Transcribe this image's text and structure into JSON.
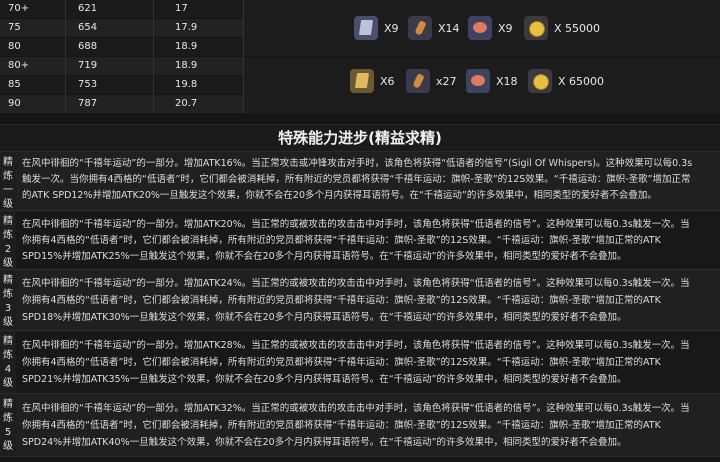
{
  "stats_rows": [
    {
      "level": "70+",
      "atk": "621",
      "sub": "17"
    },
    {
      "level": "75",
      "atk": "654",
      "sub": "17.9"
    },
    {
      "level": "80",
      "atk": "688",
      "sub": "18.9"
    },
    {
      "level": "80+",
      "atk": "719",
      "sub": "18.9"
    },
    {
      "level": "85",
      "atk": "753",
      "sub": "19.8"
    },
    {
      "level": "90",
      "atk": "787",
      "sub": "20.7"
    }
  ],
  "materials": [
    {
      "items": [
        {
          "icon": "book-icon",
          "qty": "X9"
        },
        {
          "icon": "bottle-icon",
          "qty": "X14"
        },
        {
          "icon": "mask-icon",
          "qty": "X9"
        },
        {
          "icon": "coin-icon",
          "qty": "X 55000"
        }
      ]
    },
    {
      "items": [
        {
          "icon": "golden-book-icon",
          "qty": "X6"
        },
        {
          "icon": "bottle-icon",
          "qty": "x27"
        },
        {
          "icon": "mask-icon",
          "qty": "X18"
        },
        {
          "icon": "coin-icon",
          "qty": "X 65000"
        }
      ]
    }
  ],
  "section_title": "特殊能力进步(精益求精)",
  "refinements": [
    {
      "tag": "精炼一级",
      "lines": [
        "在风中徘徊的“千禧年运动”的一部分。增加ATK16%。当正常攻击或冲锋攻击对手时，该角色将获得“低语者的信号”(Sigil Of Whispers)。这种效果可以每0.3s",
        "触发一次。当你拥有4西格的“低语者”时，它们都会被消耗掉，所有附近的党员都将获得“千禧年运动：旗帜-圣歌”的12S效果。“千禧运动：旗帜-圣歌”增加正常",
        "的ATK SPD12%并增加ATK20%一旦触发这个效果，你就不会在20多个月内获得耳语符号。在“千禧运动”的许多效果中，相同类型的爱好者不会叠加。"
      ]
    },
    {
      "tag": "精炼2级",
      "lines": [
        "在风中徘徊的“千禧年运动”的一部分。增加ATK20%。当正常的或被攻击的攻击击中对手时，该角色将获得“低语者的信号”。这种效果可以每0.3s触发一次。当",
        "你拥有4西格的“低语者”时，它们都会被消耗掉，所有附近的党员都将获得“千禧年运动：旗帜-圣歌”的12S效果。“千禧运动：旗帜-圣歌”增加正常的ATK",
        "SPD15%并增加ATK25%一旦触发这个效果，你就不会在20多个月内获得耳语符号。在“千禧运动”的许多效果中，相同类型的爱好者不会叠加。"
      ]
    },
    {
      "tag": "精炼3级",
      "lines": [
        "在风中徘徊的“千禧年运动”的一部分。增加ATK24%。当正常的或被攻击的攻击击中对手时，该角色将获得“低语者的信号”。这种效果可以每0.3s触发一次。当",
        "你拥有4西格的“低语者”时，它们都会被消耗掉，所有附近的党员都将获得“千禧年运动：旗帜-圣歌”的12S效果。“千禧运动：旗帜-圣歌”增加正常的ATK",
        "SPD18%并增加ATK30%一旦触发这个效果，你就不会在20多个月内获得耳语符号。在“千禧运动”的许多效果中，相同类型的爱好者不会叠加。"
      ]
    },
    {
      "tag": "精炼4级",
      "lines": [
        "在风中徘徊的“千禧年运动”的一部分。增加ATK28%。当正常的或被攻击的攻击击中对手时，该角色将获得“低语者的信号”。这种效果可以每0.3s触发一次。当",
        "你拥有4西格的“低语者”时，它们都会被消耗掉，所有附近的党员都将获得“千禧年运动：旗帜-圣歌”的12S效果。“千禧运动：旗帜-圣歌”增加正常的ATK",
        "SPD21%并增加ATK35%一旦触发这个效果，你就不会在20多个月内获得耳语符号。在“千禧运动”的许多效果中，相同类型的爱好者不会叠加。"
      ]
    },
    {
      "tag": "精炼5级",
      "lines": [
        "在风中徘徊的“千禧年运动”的一部分。增加ATK32%。当正常的或被攻击的攻击击中对手时，该角色将获得“低语者的信号”。这种效果可以每0.3s触发一次。当",
        "你拥有4西格的“低语者”时，它们都会被消耗掉，所有附近的党员都将获得“千禧年运动：旗帜-圣歌”的12S效果。“千禧运动：旗帜-圣歌”增加正常的ATK",
        "SPD24%并增加ATK40%一旦触发这个效果，你就不会在20多个月内获得耳语符号。在“千禧运动”的许多效果中，相同类型的爱好者不会叠加。"
      ]
    }
  ]
}
